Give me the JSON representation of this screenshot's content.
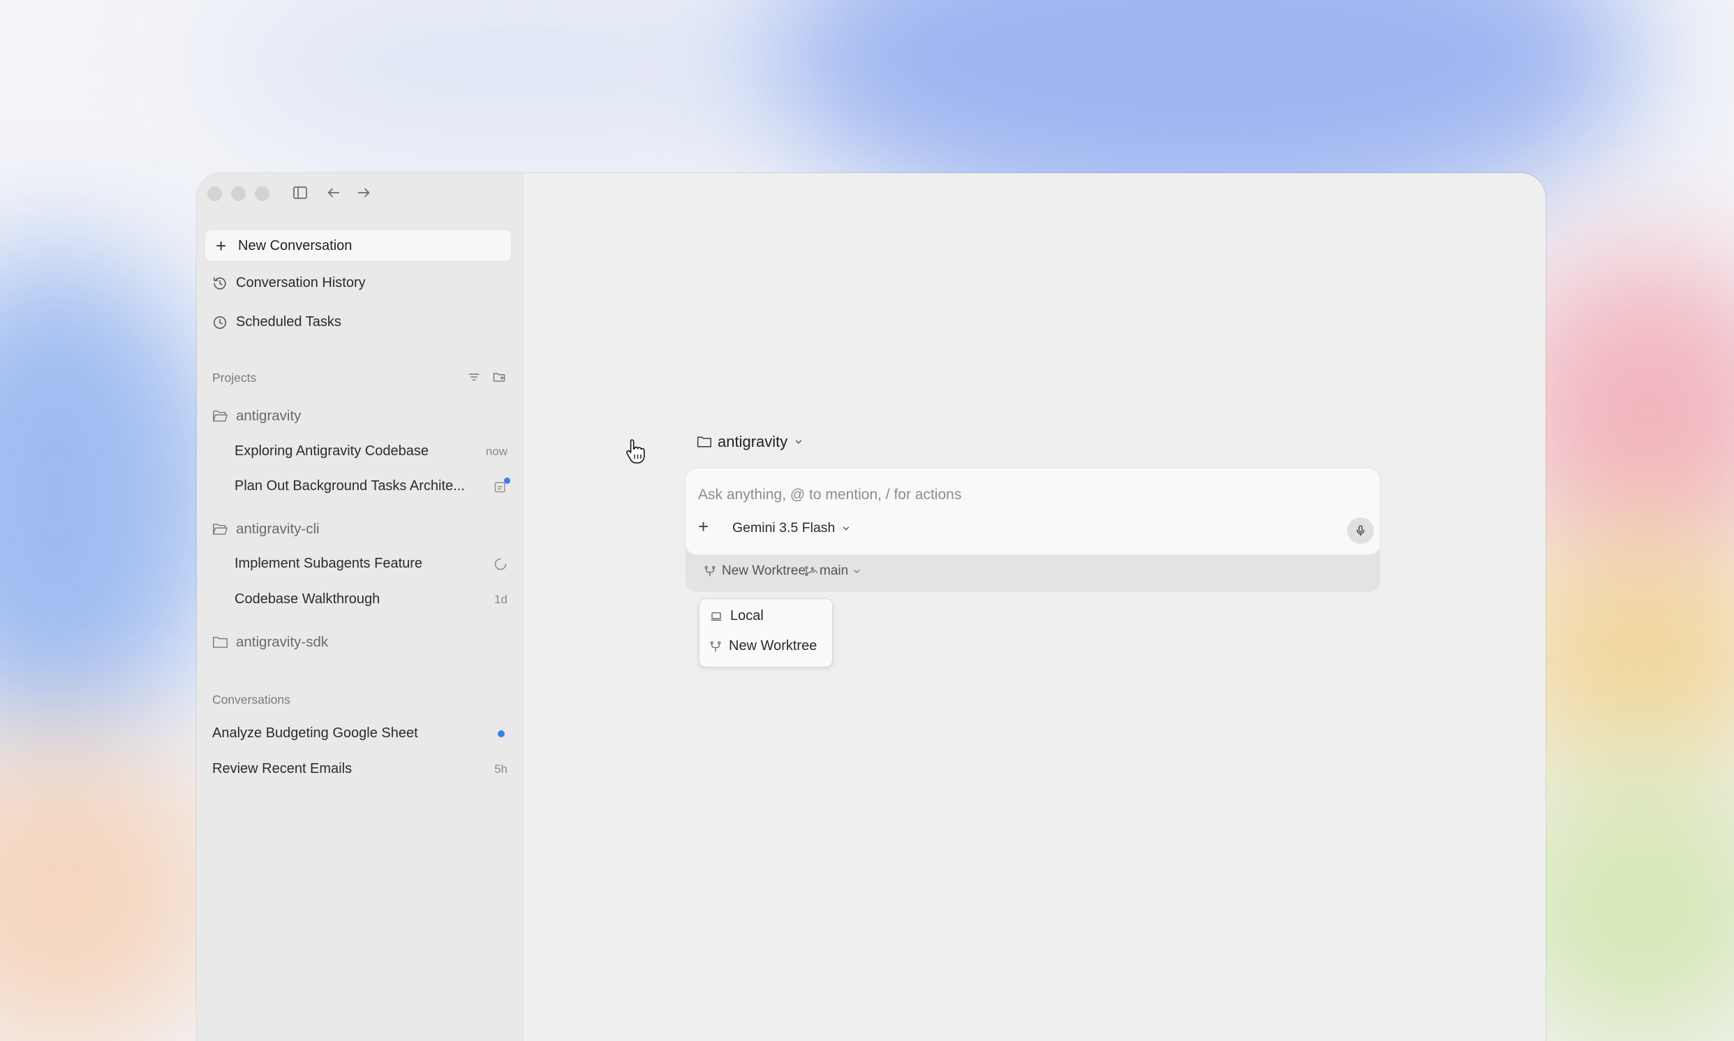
{
  "sidebar": {
    "new_conversation": "New Conversation",
    "conversation_history": "Conversation History",
    "scheduled_tasks": "Scheduled Tasks",
    "projects_label": "Projects",
    "projects": [
      {
        "name": "antigravity",
        "conversations": [
          {
            "title": "Exploring Antigravity Codebase",
            "meta": "now"
          },
          {
            "title": "Plan Out Background Tasks Archite...",
            "meta": ""
          }
        ]
      },
      {
        "name": "antigravity-cli",
        "conversations": [
          {
            "title": "Implement Subagents Feature",
            "meta": ""
          },
          {
            "title": "Codebase Walkthrough",
            "meta": "1d"
          }
        ]
      },
      {
        "name": "antigravity-sdk",
        "conversations": []
      }
    ],
    "conversations_label": "Conversations",
    "conversations": [
      {
        "title": "Analyze Budgeting Google Sheet",
        "meta": ""
      },
      {
        "title": "Review Recent Emails",
        "meta": "5h"
      }
    ]
  },
  "main": {
    "folder": "antigravity",
    "placeholder": "Ask anything, @ to mention, / for actions",
    "model": "Gemini 3.5 Flash",
    "worktree": "New Worktree",
    "branch": "main",
    "dropdown": {
      "items": [
        "Local",
        "New Worktree"
      ]
    }
  },
  "colors": {
    "accent": "#3d7fe6",
    "window_bg": "#efefef",
    "sidebar_bg": "#e9e9e9"
  }
}
